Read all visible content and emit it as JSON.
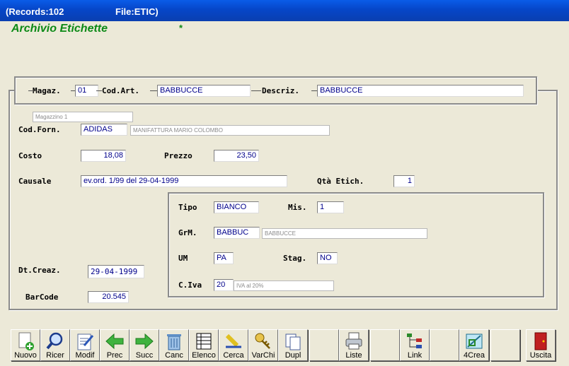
{
  "titlebar": {
    "records": "(Records:102",
    "file": "File:ETIC)"
  },
  "form": {
    "title": "Archivio Etichette",
    "modified_marker": "*"
  },
  "key": {
    "magaz_label": "Magaz.",
    "magaz_value": "01",
    "codart_label": "Cod.Art.",
    "codart_value": "BABBUCCE",
    "descriz_label": "Descriz.",
    "descriz_value": "BABBUCCE"
  },
  "detail": {
    "magazzino_desc": "Magazzino 1",
    "codforn_label": "Cod.Forn.",
    "codforn_value": "ADIDAS",
    "codforn_desc": "MANIFATTURA MARIO COLOMBO",
    "costo_label": "Costo",
    "costo_value": "18,08",
    "prezzo_label": "Prezzo",
    "prezzo_value": "23,50",
    "causale_label": "Causale",
    "causale_value": "ev.ord. 1/99 del 29-04-1999",
    "qta_label": "Qtà Etich.",
    "qta_value": "1",
    "dtcreaz_label": "Dt.Creaz.",
    "dtcreaz_value": "29-04-1999",
    "barcode_label": "BarCode",
    "barcode_value": "20.545"
  },
  "subframe": {
    "tipo_label": "Tipo",
    "tipo_value": "BIANCO",
    "mis_label": "Mis.",
    "mis_value": "1",
    "grm_label": "GrM.",
    "grm_value": "BABBUC",
    "grm_desc": "BABBUCCE",
    "um_label": "UM",
    "um_value": "PA",
    "stag_label": "Stag.",
    "stag_value": "NO",
    "civa_label": "C.Iva",
    "civa_value": "20",
    "civa_desc": "IVA al 20%"
  },
  "toolbar": {
    "nuovo": "Nuovo",
    "ricer": "Ricer",
    "modif": "Modif",
    "prec": "Prec",
    "succ": "Succ",
    "canc": "Canc",
    "elenco": "Elenco",
    "cerca": "Cerca",
    "varchi": "VarChi",
    "dupl": "Dupl",
    "liste": "Liste",
    "link": "Link",
    "crea": "4Crea",
    "uscita": "Uscita"
  },
  "icons": [
    "add-document-icon",
    "magnifier-icon",
    "edit-document-icon",
    "left-arrow-icon",
    "right-arrow-icon",
    "trash-icon",
    "list-icon",
    "marker-icon",
    "keys-icon",
    "copy-icon",
    "printer-icon",
    "tree-icon",
    "drafting-icon",
    "exit-door-icon"
  ],
  "colors": {
    "title_green": "#0c8a16",
    "field_text": "#00008b",
    "titlebar_blue": "#0646c8"
  }
}
